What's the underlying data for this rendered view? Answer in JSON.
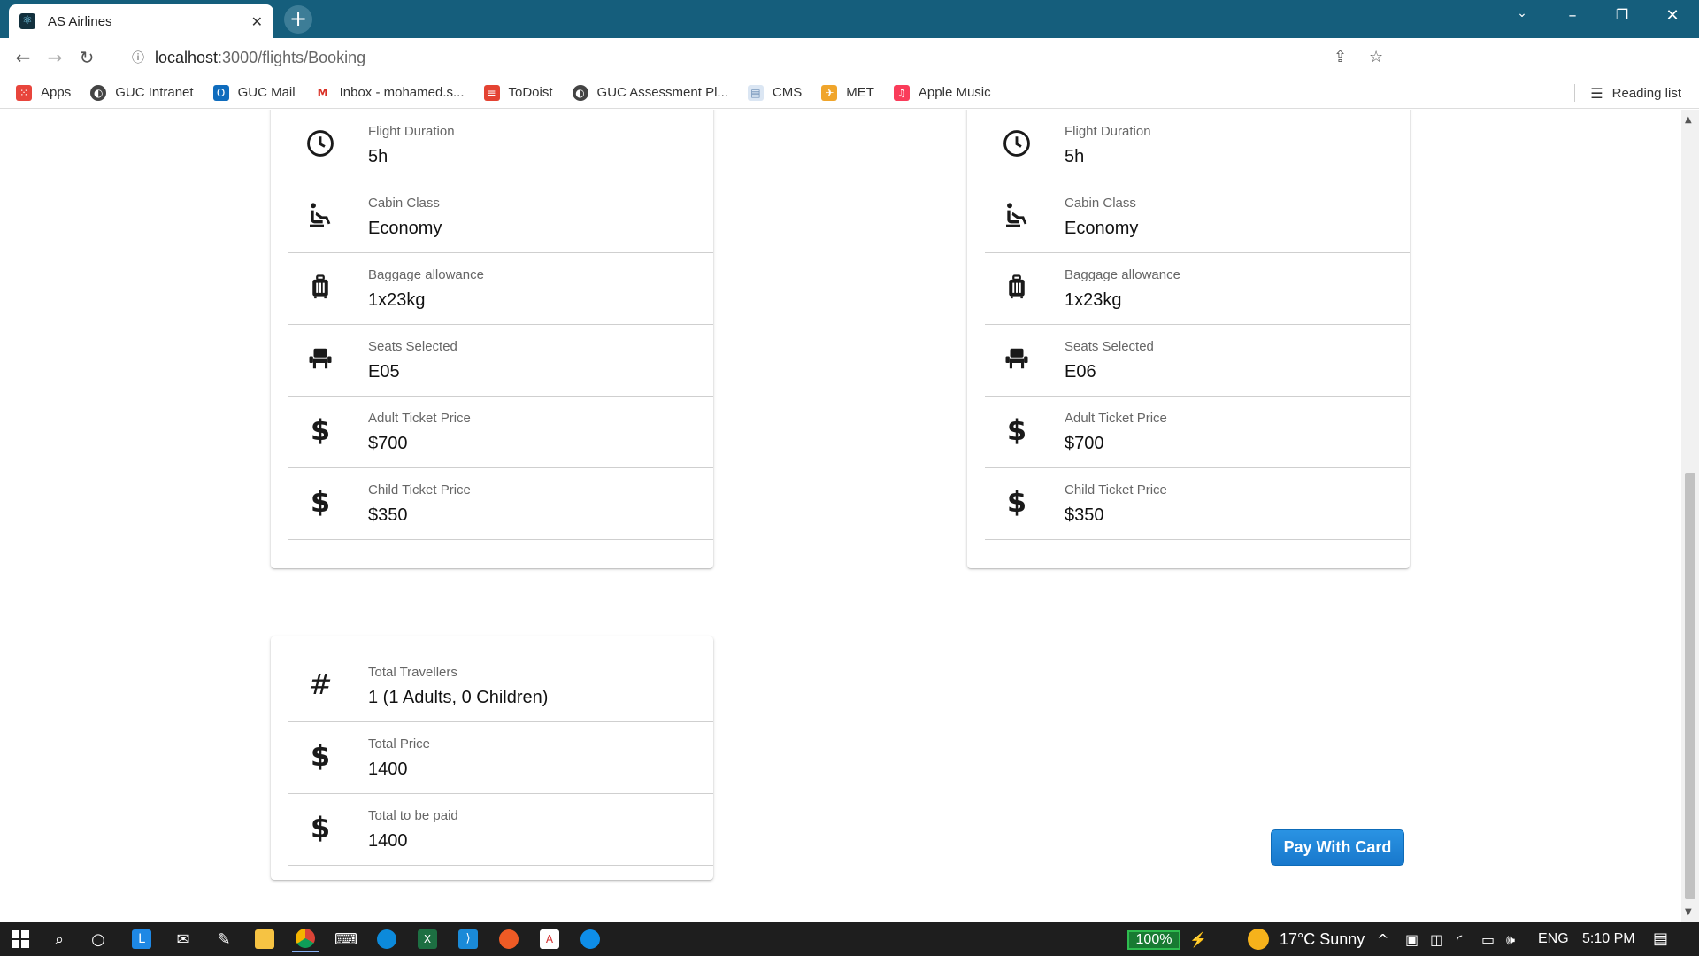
{
  "browser": {
    "tab_title": "AS Airlines",
    "url_host": "localhost",
    "url_path": ":3000/flights/Booking",
    "bookmarks": [
      {
        "label": "Apps",
        "icon": "apps-grid-icon",
        "color": "#e8453c"
      },
      {
        "label": "GUC Intranet",
        "icon": "globe-icon",
        "color": "#444444"
      },
      {
        "label": "GUC Mail",
        "icon": "outlook-icon",
        "color": "#0f6cbd"
      },
      {
        "label": "Inbox - mohamed.s...",
        "icon": "gmail-icon",
        "color": "#d93025"
      },
      {
        "label": "ToDoist",
        "icon": "todoist-icon",
        "color": "#e44332"
      },
      {
        "label": "GUC Assessment Pl...",
        "icon": "globe-icon",
        "color": "#444444"
      },
      {
        "label": "CMS",
        "icon": "document-icon",
        "color": "#9fb7d4"
      },
      {
        "label": "MET",
        "icon": "met-icon",
        "color": "#f0a52b"
      },
      {
        "label": "Apple Music",
        "icon": "apple-music-icon",
        "color": "#fa3c5a"
      }
    ],
    "reading_list": "Reading list"
  },
  "outbound": {
    "rows": [
      {
        "label": "Flight Duration",
        "value": "5h",
        "icon": "clock-icon"
      },
      {
        "label": "Cabin Class",
        "value": "Economy",
        "icon": "airline-seat-icon"
      },
      {
        "label": "Baggage allowance",
        "value": "1x23kg",
        "icon": "luggage-icon"
      },
      {
        "label": "Seats Selected",
        "value": "E05",
        "icon": "seat-icon"
      },
      {
        "label": "Adult Ticket Price",
        "value": "$700",
        "icon": "dollar-icon"
      },
      {
        "label": "Child Ticket Price",
        "value": "$350",
        "icon": "dollar-icon"
      }
    ]
  },
  "return": {
    "rows": [
      {
        "label": "Flight Duration",
        "value": "5h",
        "icon": "clock-icon"
      },
      {
        "label": "Cabin Class",
        "value": "Economy",
        "icon": "airline-seat-icon"
      },
      {
        "label": "Baggage allowance",
        "value": "1x23kg",
        "icon": "luggage-icon"
      },
      {
        "label": "Seats Selected",
        "value": "E06",
        "icon": "seat-icon"
      },
      {
        "label": "Adult Ticket Price",
        "value": "$700",
        "icon": "dollar-icon"
      },
      {
        "label": "Child Ticket Price",
        "value": "$350",
        "icon": "dollar-icon"
      }
    ]
  },
  "summary": {
    "rows": [
      {
        "label": "Total Travellers",
        "value": "1 (1 Adults, 0 Children)",
        "icon": "hash-icon"
      },
      {
        "label": "Total Price",
        "value": "1400",
        "icon": "dollar-icon"
      },
      {
        "label": "Total to be paid",
        "value": "1400",
        "icon": "dollar-icon"
      }
    ]
  },
  "pay_button": "Pay With Card",
  "taskbar": {
    "battery": "100%",
    "weather": "17°C  Sunny",
    "language": "ENG",
    "time": "5:10 PM"
  },
  "colors": {
    "tab_strip": "#155e7c",
    "pay_button": "#1f86d6"
  }
}
